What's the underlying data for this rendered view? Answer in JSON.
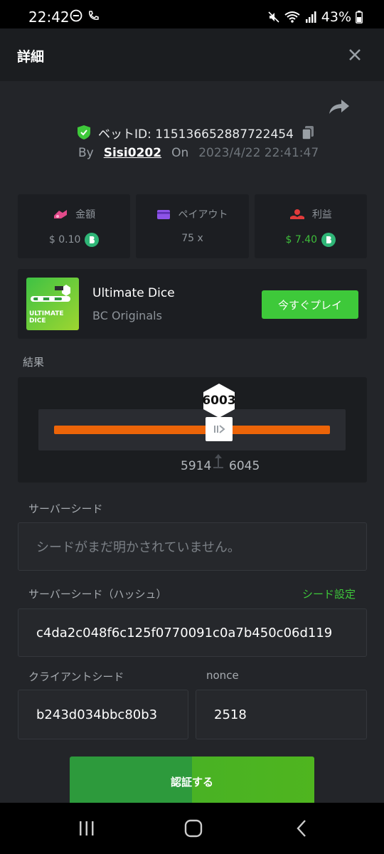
{
  "status_bar": {
    "time": "22:42",
    "battery": "43%",
    "icons_left": [
      "do-not-disturb-icon",
      "phone-icon"
    ],
    "icons_right": [
      "mute-icon",
      "wifi-icon",
      "signal-icon",
      "battery-icon"
    ]
  },
  "modal": {
    "title": "詳細"
  },
  "bet": {
    "bet_id_label": "ベットID: 115136652887722454",
    "by_label": "By",
    "user": "Sisi0202",
    "on_label": "On",
    "datetime": "2023/4/22 22:41:47"
  },
  "stats": [
    {
      "label": "金額",
      "value": "$ 0.10",
      "icon": "amount-icon",
      "color": "#e24a8a"
    },
    {
      "label": "ペイアウト",
      "value": "75 x",
      "icon": "wallet-icon",
      "color": "#8d53e8"
    },
    {
      "label": "利益",
      "value": "$ 7.40",
      "icon": "profit-icon",
      "color": "#e23b3b"
    }
  ],
  "game": {
    "name": "Ultimate Dice",
    "provider": "BC Originals",
    "play_label": "今すぐプレイ",
    "thumb_text_1": "ULTIMATE",
    "thumb_text_2": "DICE"
  },
  "result": {
    "label": "結果",
    "value": "6003",
    "range_low": "5914",
    "range_high": "6045"
  },
  "server_seed": {
    "label": "サーバーシード",
    "placeholder": "シードがまだ明かされていません。"
  },
  "server_seed_hash": {
    "label": "サーバーシード（ハッシュ）",
    "action": "シード設定",
    "value": "c4da2c048f6c125f0770091c0a7b450c06d119"
  },
  "client_seed": {
    "label": "クライアントシード",
    "value": "b243d034bbc80b3"
  },
  "nonce": {
    "label": "nonce",
    "value": "2518"
  },
  "verify": {
    "label": "認証する"
  },
  "colors": {
    "accent_green": "#3ec93a",
    "bar_orange": "#ec6408",
    "coin_green": "#2fb677"
  }
}
